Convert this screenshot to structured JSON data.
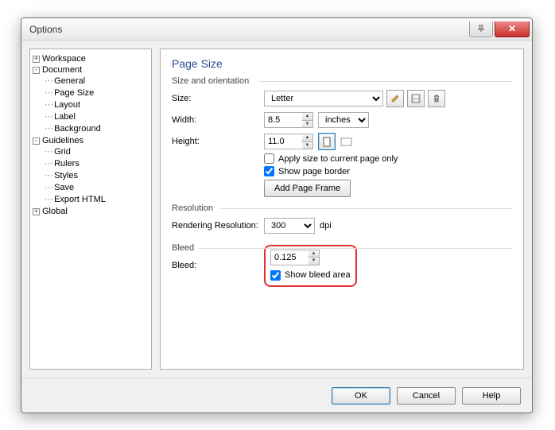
{
  "dialog": {
    "title": "Options"
  },
  "tree": {
    "workspace": "Workspace",
    "document": "Document",
    "doc_children": {
      "general": "General",
      "pagesize": "Page Size",
      "layout": "Layout",
      "label": "Label",
      "background": "Background"
    },
    "guidelines": "Guidelines",
    "guide_children": {
      "grid": "Grid",
      "rulers": "Rulers",
      "styles": "Styles",
      "save": "Save",
      "export": "Export HTML"
    },
    "global": "Global"
  },
  "panel": {
    "heading": "Page Size",
    "size_section": "Size and orientation",
    "size_label": "Size:",
    "size_value": "Letter",
    "width_label": "Width:",
    "width_value": "8.5",
    "units_value": "inches",
    "height_label": "Height:",
    "height_value": "11.0",
    "apply_current": "Apply size to current page only",
    "show_border": "Show page border",
    "add_frame": "Add Page Frame",
    "resolution_section": "Resolution",
    "resolution_label": "Rendering Resolution:",
    "resolution_value": "300",
    "resolution_unit": "dpi",
    "bleed_section": "Bleed",
    "bleed_label": "Bleed:",
    "bleed_value": "0.125",
    "show_bleed": "Show bleed area"
  },
  "buttons": {
    "ok": "OK",
    "cancel": "Cancel",
    "help": "Help"
  }
}
